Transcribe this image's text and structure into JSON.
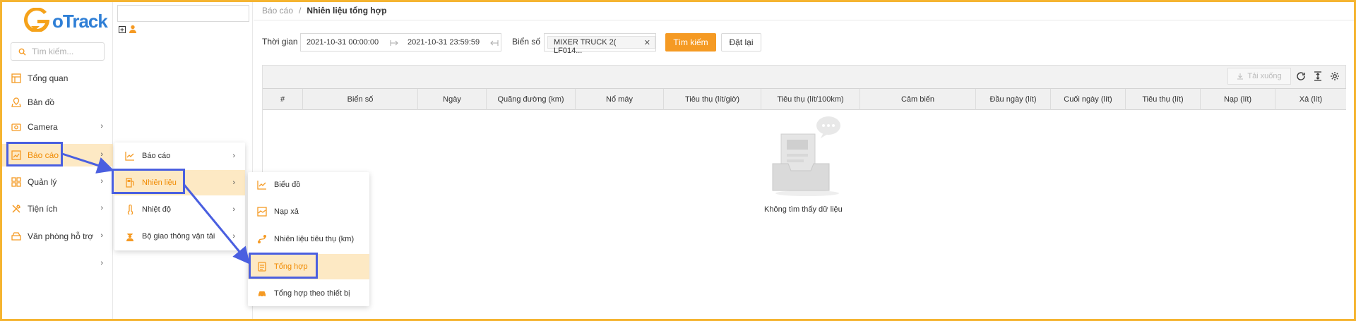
{
  "app": {
    "logo_text": "oTrack"
  },
  "sidebar": {
    "search_placeholder": "Tìm kiếm...",
    "items": [
      {
        "label": "Tổng quan",
        "icon": "dashboard-icon"
      },
      {
        "label": "Bản đồ",
        "icon": "map-icon"
      },
      {
        "label": "Camera",
        "icon": "camera-icon"
      },
      {
        "label": "Báo cáo",
        "icon": "report-icon",
        "active": true
      },
      {
        "label": "Quản lý",
        "icon": "apps-icon"
      },
      {
        "label": "Tiện ích",
        "icon": "tools-icon"
      },
      {
        "label": "Văn phòng hỗ trợ",
        "icon": "office-icon"
      }
    ]
  },
  "breadcrumb": {
    "parent": "Báo cáo",
    "separator": "/",
    "current": "Nhiên liệu tổng hợp"
  },
  "filters": {
    "time_label": "Thời gian",
    "start": "2021-10-31 00:00:00",
    "end": "2021-10-31 23:59:59",
    "plate_label": "Biển số",
    "plate_value": "MIXER TRUCK 2( LF014...",
    "search_button": "Tìm kiếm",
    "reset_button": "Đặt lại"
  },
  "toolbar": {
    "download_label": "Tải xuống"
  },
  "table": {
    "columns": [
      "#",
      "Biển số",
      "Ngày",
      "Quãng đường (km)",
      "Nổ máy",
      "Tiêu thụ (lít/giờ)",
      "Tiêu thụ (lít/100km)",
      "Cảm biến",
      "Đầu ngày (lít)",
      "Cuối ngày (lít)",
      "Tiêu thụ (lít)",
      "Nạp (lít)",
      "Xả (lít)"
    ],
    "empty_text": "Không tìm thấy dữ liệu"
  },
  "menu_level1": {
    "items": [
      {
        "label": "Báo cáo",
        "icon": "line-chart-icon"
      },
      {
        "label": "Nhiên liệu",
        "icon": "fuel-icon",
        "active": true
      },
      {
        "label": "Nhiệt độ",
        "icon": "thermometer-icon"
      },
      {
        "label": "Bộ giao thông vận tải",
        "icon": "officer-icon"
      }
    ]
  },
  "menu_level2": {
    "items": [
      {
        "label": "Biểu đồ",
        "icon": "line-chart-icon"
      },
      {
        "label": "Nạp xả",
        "icon": "area-chart-icon"
      },
      {
        "label": "Nhiên liệu tiêu thụ (km)",
        "icon": "route-icon"
      },
      {
        "label": "Tổng hợp",
        "icon": "summary-doc-icon",
        "active": true
      },
      {
        "label": "Tổng hợp theo thiết bị",
        "icon": "car-icon"
      }
    ]
  },
  "colors": {
    "accent": "#f59a23",
    "active_bg": "#fde9c4",
    "highlight": "#4a5fe0",
    "frame": "#f5b431"
  }
}
